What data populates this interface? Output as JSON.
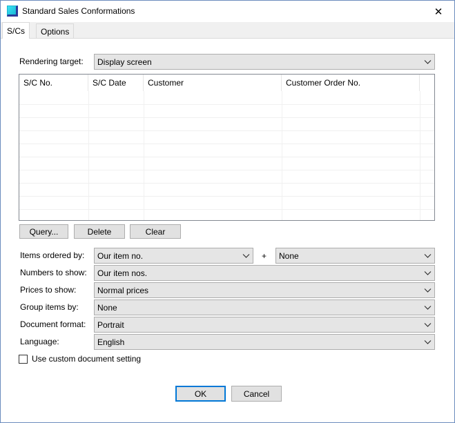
{
  "window": {
    "title": "Standard Sales Conformations",
    "close_glyph": "✕"
  },
  "tabs": [
    {
      "label": "S/Cs",
      "active": true
    },
    {
      "label": "Options",
      "active": false
    }
  ],
  "rendering_target": {
    "label": "Rendering target:",
    "value": "Display screen"
  },
  "sc_list": {
    "columns": [
      "S/C No.",
      "S/C Date",
      "Customer",
      "Customer Order No."
    ],
    "rows": []
  },
  "list_buttons": {
    "query": "Query...",
    "delete": "Delete",
    "clear": "Clear"
  },
  "options": {
    "items_ordered_by": {
      "label": "Items ordered by:",
      "value": "Our item no.",
      "plus": "+",
      "second_value": "None"
    },
    "numbers_to_show": {
      "label": "Numbers to show:",
      "value": "Our item nos."
    },
    "prices_to_show": {
      "label": "Prices to show:",
      "value": "Normal prices"
    },
    "group_items_by": {
      "label": "Group items by:",
      "value": "None"
    },
    "document_format": {
      "label": "Document format:",
      "value": "Portrait"
    },
    "language": {
      "label": "Language:",
      "value": "English"
    }
  },
  "custom_setting": {
    "label": "Use custom document setting",
    "checked": false
  },
  "dialog_buttons": {
    "ok": "OK",
    "cancel": "Cancel"
  },
  "icons": {
    "app": "app-icon",
    "close": "close-icon",
    "dropdown": "chevron-down-icon"
  },
  "colors": {
    "accent": "#0078d7",
    "window_border": "#6a8bbd"
  }
}
